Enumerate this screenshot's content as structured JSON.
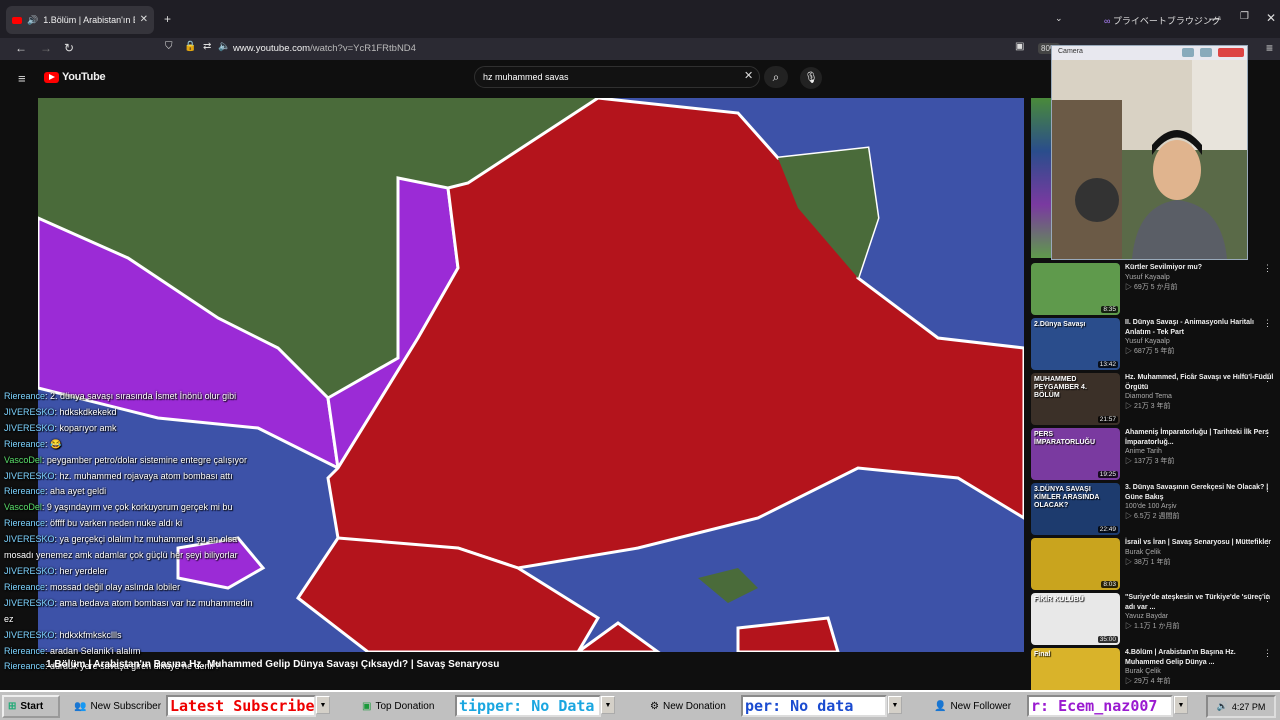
{
  "browser": {
    "tab_title": "1.Bölüm | Arabistan'ın Başın",
    "private_label": "プライベートブラウジング",
    "url_host": "www.youtube.com",
    "url_path": "/watch?v=YcR1FRtbND4",
    "zoom": "80%"
  },
  "youtube": {
    "logo": "YouTube",
    "search_value": "hz muhammed savas",
    "video_title": "1.Bölüm | Arabistan'ın Başına Hz. Muhammed Gelip Dünya Savaşı Çıksaydı? | Savaş Senaryosu"
  },
  "camera": {
    "title": "Camera"
  },
  "chat": [
    {
      "user": "Riereance",
      "msg": "2. dünya savaşı sırasında İsmet İnönü olur gibi"
    },
    {
      "user": "JIVERESKO",
      "msg": "hdkskdkekekd"
    },
    {
      "user": "JIVERESKO",
      "msg": "koparıyor amk"
    },
    {
      "user": "Riereance",
      "msg": "😂"
    },
    {
      "user": "VascoDel",
      "msg": "peygamber petro/dolar sistemine entegre çalışıyor"
    },
    {
      "user": "JIVERESKO",
      "msg": "hz. muhammed rojavaya atom bombası attı"
    },
    {
      "user": "Riereance",
      "msg": "aha ayet geldi"
    },
    {
      "user": "VascoDel",
      "msg": "9 yaşındayım ve çok korkuyorum gerçek mi bu"
    },
    {
      "user": "Riereance",
      "msg": "öffff bu varken neden nuke aldı ki"
    },
    {
      "user": "JIVERESKO",
      "msg": "ya gerçekçi olalım hz muhammed şu an olsa mosadı yenemez amk adamlar çok güçlü her şeyi biliyorlar"
    },
    {
      "user": "JIVERESKO",
      "msg": "her yerdeler"
    },
    {
      "user": "Riereance",
      "msg": "mossad değil olay aslında lobiler"
    },
    {
      "user": "JIVERESKO",
      "msg": "ama bedava atom bombası var hz muhammedin ez"
    },
    {
      "user": "JIVERESKO",
      "msg": "hdkxkfmkskcllls"
    },
    {
      "user": "Riereance",
      "msg": "aradan Selanik'i alalım"
    },
    {
      "user": "Riereance",
      "msg": "durduk yere savaşa giren ülkeye ne denir?"
    }
  ],
  "recommendations": [
    {
      "title": "Kürtler Sevilmiyor mu?",
      "channel": "Yusuf Kayaalp",
      "meta": "▷ 69万 5 か月前",
      "duration": "8:35",
      "color": "#5f9a4c"
    },
    {
      "title": "II. Dünya Savaşı - Animasyonlu Haritalı Anlatım - Tek Part",
      "channel": "Yusuf Kayaalp",
      "meta": "▷ 687万 5 年前",
      "duration": "13:42",
      "color": "#2a4d8c"
    },
    {
      "title": "Hz. Muhammed, Ficâr Savaşı ve Hılfü'l-Füdûl Örgütü",
      "channel": "Diamond Tema",
      "meta": "▷ 21万 3 年前",
      "duration": "21:57",
      "color": "#3b3028"
    },
    {
      "title": "Ahameniş İmparatorluğu | Tarihteki İlk Pers İmparatorluğ...",
      "channel": "Anime Tarih",
      "meta": "▷ 137万 3 年前",
      "duration": "19:25",
      "color": "#7a3aa0"
    },
    {
      "title": "3. Dünya Savaşının Gerekçesi Ne Olacak? | Güne Bakış",
      "channel": "100'de 100 Arşiv",
      "meta": "▷ 6.5万 2 週間前",
      "duration": "22:49",
      "color": "#1d3b6e"
    },
    {
      "title": "İsrail vs İran | Savaş Senaryosu | Müttefikler",
      "channel": "Burak Çelik",
      "meta": "▷ 38万 1 年前",
      "duration": "8:03",
      "color": "#c9a41e"
    },
    {
      "title": "\"Suriye'de ateşkesin ve Türkiye'de 'süreç'in adı var ...",
      "channel": "Yavuz Baydar",
      "meta": "▷ 1.1万 1 か月前",
      "duration": "35:00",
      "color": "#e8e8e8"
    },
    {
      "title": "4.Bölüm | Arabistan'ın Başına Hz. Muhammed Gelip Dünya ...",
      "channel": "Burak Çelik",
      "meta": "▷ 29万 4 年前",
      "duration": "",
      "color": "#d9b32a"
    }
  ],
  "thumb_labels": {
    "r2": "2.Dünya Savaşı",
    "r3": "MUHAMMED PEYGAMBER 4. BÖLÜM",
    "r4": "PERS İMPARATORLUĞU",
    "r5": "3.DÜNYA SAVAŞI KİMLER ARASINDA OLACAK?",
    "r7": "FİKİR KULÜBÜ",
    "r8": "Final"
  },
  "taskbar": {
    "start": "Start",
    "new_subscriber": "New Subscriber",
    "ticker1": "Latest Subscriber",
    "top_donation": "Top Donation",
    "ticker2": "tipper: No Data",
    "new_donation": "New Donation",
    "ticker3": "per: No data",
    "new_follower": "New Follower",
    "ticker4": "r: Ecem_naz007",
    "clock": "4:27 PM"
  }
}
